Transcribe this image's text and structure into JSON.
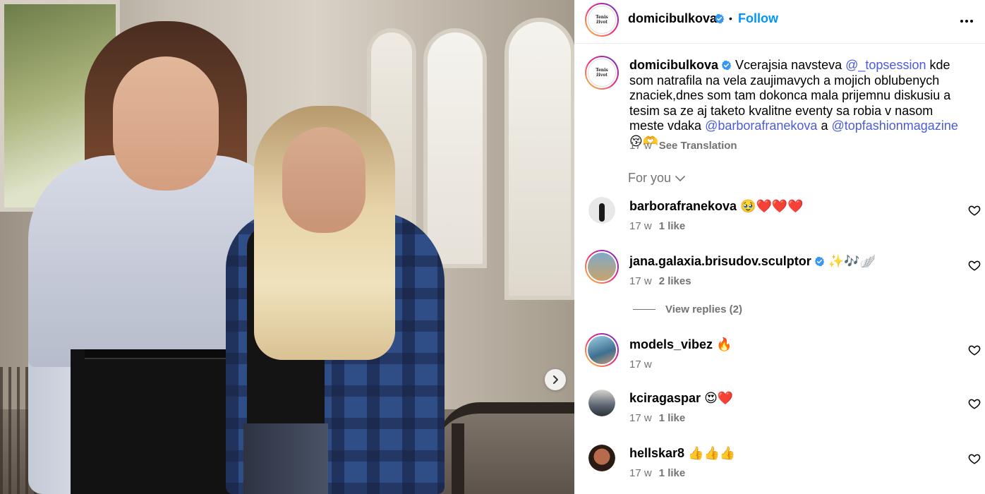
{
  "post": {
    "author": "domicibulkova",
    "follow_label": "Follow",
    "dot": "•",
    "avatar_logo_text": "Tenis život",
    "caption_username": "domicibulkova",
    "caption_parts": {
      "p1": "Vcerajsia navsteva ",
      "m1": "@_topsession",
      "p2": " kde som natrafila na vela zaujimavych a mojich oblubenych znaciek,dnes som tam dokonca mala prijemnu diskusiu a tesim sa ze aj taketo kvalitne eventy sa robia v nasom meste vdaka ",
      "m2": "@barborafranekova",
      "p3": " a ",
      "m3": "@topfashionmagazine",
      "p4": " 😚🫶"
    },
    "caption_time": "17 w",
    "see_translation": "See Translation",
    "for_you": "For you"
  },
  "comments": [
    {
      "username": "barborafranekova",
      "text": "🥹❤️❤️❤️",
      "time": "17 w",
      "likes": "1 like",
      "verified": false,
      "ring": false,
      "avatar_color": "#cfcfcf"
    },
    {
      "username": "jana.galaxia.brisudov.sculptor",
      "text": "✨🎶🪽",
      "time": "17 w",
      "likes": "2 likes",
      "verified": true,
      "ring": true,
      "avatar_color": "#c9a36a"
    },
    {
      "username": "models_vibez",
      "text": "🔥",
      "time": "17 w",
      "likes": "",
      "verified": false,
      "ring": true,
      "avatar_color": "#5a8fb5"
    },
    {
      "username": "kciragaspar",
      "text": "😍❤️",
      "time": "17 w",
      "likes": "1 like",
      "verified": false,
      "ring": false,
      "avatar_color": "#4b5560"
    },
    {
      "username": "hellskar8",
      "text": "👍👍👍",
      "time": "17 w",
      "likes": "1 like",
      "verified": false,
      "ring": false,
      "avatar_color": "#b86a4c"
    }
  ],
  "view_replies": "View replies (2)",
  "colors": {
    "accent": "#0095f6",
    "mention": "#4a5cd9",
    "muted": "#737373",
    "verified": "#0095f6"
  },
  "icons": {
    "next": "chevron-right-icon",
    "more": "more-horizontal-icon",
    "like": "heart-outline-icon",
    "verified": "verified-badge-icon",
    "expand": "chevron-down-icon"
  }
}
